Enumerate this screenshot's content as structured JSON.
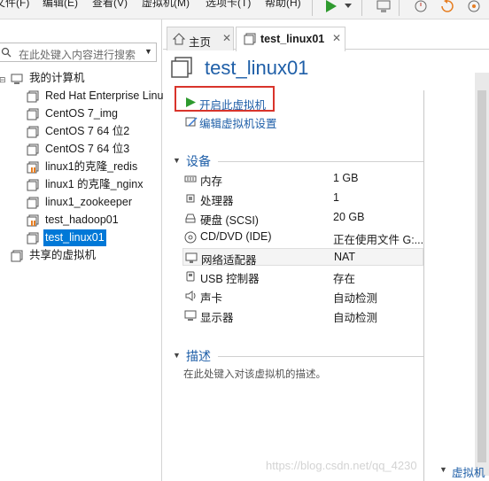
{
  "menu": {
    "items": [
      "文件(F)",
      "编辑(E)",
      "查看(V)",
      "虚拟机(M)",
      "选项卡(T)",
      "帮助(H)"
    ]
  },
  "library": {
    "search_placeholder": "在此处键入内容进行搜索",
    "root_label": "我的计算机",
    "vms": [
      "Red Hat Enterprise Linux",
      "CentOS 7_img",
      "CentOS 7 64 位2",
      "CentOS 7 64 位3",
      "linux1的克隆_redis",
      "linux1 的克隆_nginx",
      "linux1_zookeeper",
      "test_hadoop01",
      "test_linux01"
    ],
    "selected_vm": "test_linux01",
    "shared_label": "共享的虚拟机"
  },
  "tabs": [
    {
      "label": "主页",
      "icon": "home-icon"
    },
    {
      "label": "test_linux01",
      "icon": "vm-icon"
    }
  ],
  "vm": {
    "title": "test_linux01",
    "actions": {
      "power_on": "开启此虚拟机",
      "edit_settings": "编辑虚拟机设置"
    },
    "devices_title": "设备",
    "devices": [
      {
        "name": "内存",
        "value": "1 GB",
        "icon": "memory-icon"
      },
      {
        "name": "处理器",
        "value": "1",
        "icon": "cpu-icon"
      },
      {
        "name": "硬盘 (SCSI)",
        "value": "20 GB",
        "icon": "disk-icon"
      },
      {
        "name": "CD/DVD (IDE)",
        "value": "正在使用文件 G:...",
        "icon": "cd-icon"
      },
      {
        "name": "网络适配器",
        "value": "NAT",
        "icon": "network-icon"
      },
      {
        "name": "USB 控制器",
        "value": "存在",
        "icon": "usb-icon"
      },
      {
        "name": "声卡",
        "value": "自动检测",
        "icon": "sound-icon"
      },
      {
        "name": "显示器",
        "value": "自动检测",
        "icon": "display-icon"
      }
    ],
    "description_title": "描述",
    "description_placeholder": "在此处键入对该虚拟机的描述。",
    "bottom_section": "虚拟机"
  },
  "watermark": "https://blog.csdn.net/qq_4230",
  "colors": {
    "accent": "#1f5fa8",
    "selection": "#0078d7",
    "highlight_box": "#d9342b",
    "play": "#2e9a2e"
  }
}
